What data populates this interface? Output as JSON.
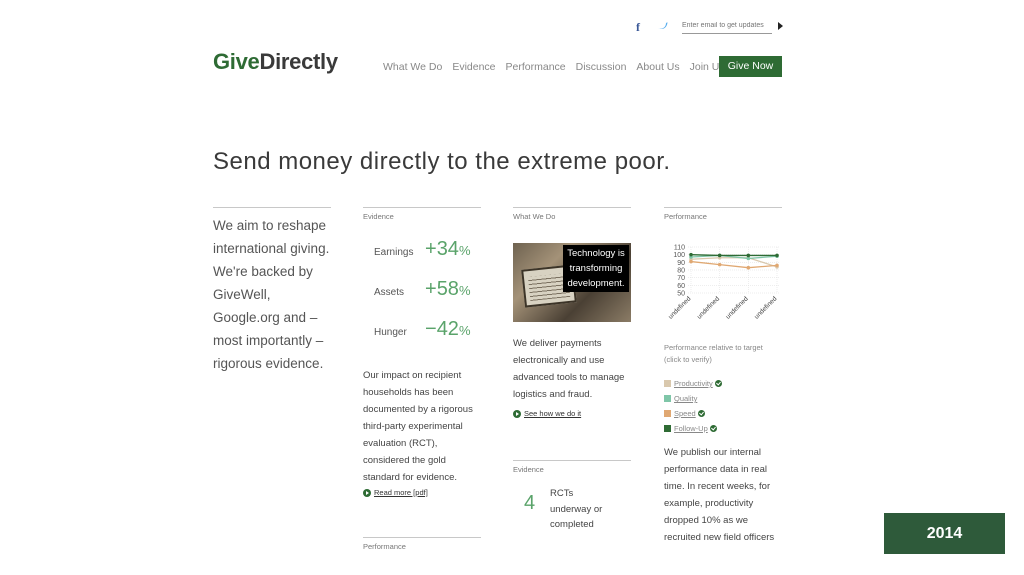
{
  "header": {
    "social": {
      "facebook_icon": "facebook-icon",
      "twitter_icon": "twitter-icon"
    },
    "email_placeholder": "Enter email to get updates",
    "logo_part1": "Give",
    "logo_part2": "Directly",
    "nav": [
      "What We Do",
      "Evidence",
      "Performance",
      "Discussion",
      "About Us",
      "Join Us"
    ],
    "cta": "Give Now",
    "brand_color": "#2e6b34"
  },
  "headline": "Send money directly to the extreme poor.",
  "intro": "We aim to reshape international giving. We're backed by GiveWell, Google.org and – most importantly – rigorous evidence.",
  "evidence": {
    "label": "Evidence",
    "stats": [
      {
        "name": "Earnings",
        "sign": "+",
        "value": "34",
        "unit": "%"
      },
      {
        "name": "Assets",
        "sign": "+",
        "value": "58",
        "unit": "%"
      },
      {
        "name": "Hunger",
        "sign": "−",
        "value": "42",
        "unit": "%"
      }
    ],
    "text": "Our impact on recipient households has been documented by a rigorous third-party experimental evaluation (RCT), considered the gold standard for evidence.",
    "link": "Read more [pdf]"
  },
  "what_we_do": {
    "label": "What We Do",
    "overlay": "Technology is transforming development.",
    "text": "We deliver payments electronically and use advanced tools to manage logistics and fraud.",
    "link": "See how we do it"
  },
  "evidence2": {
    "label": "Evidence",
    "number": "4",
    "text": "RCTs underway or completed"
  },
  "performance2": {
    "label": "Performance"
  },
  "performance": {
    "label": "Performance",
    "caption": "Performance relative to target",
    "caption2": "(click to verify)",
    "legend": [
      {
        "label": "Productivity",
        "color": "#d9c8ad"
      },
      {
        "label": "Quality",
        "color": "#7fc6a8"
      },
      {
        "label": "Speed",
        "color": "#e0a872"
      },
      {
        "label": "Follow-Up",
        "color": "#2e6b34"
      }
    ],
    "text": "We publish our internal performance data in real time. In recent weeks, for example, productivity dropped 10% as we recruited new field officers"
  },
  "chart_data": {
    "type": "line",
    "categories": [
      "undefined",
      "undefined",
      "undefined",
      "undefined"
    ],
    "y_ticks": [
      "110",
      "100",
      "90",
      "80",
      "70",
      "60",
      "50"
    ],
    "ylim": [
      50,
      110
    ],
    "grid": true,
    "series": [
      {
        "name": "Productivity",
        "color": "#d9c8ad",
        "values": [
          94,
          96,
          96,
          84
        ]
      },
      {
        "name": "Quality",
        "color": "#7fc6a8",
        "values": [
          97,
          99,
          95,
          98
        ]
      },
      {
        "name": "Speed",
        "color": "#e0a872",
        "values": [
          91,
          87,
          83,
          86
        ]
      },
      {
        "name": "Follow-Up",
        "color": "#2e6b34",
        "values": [
          100,
          99,
          99,
          99
        ]
      }
    ]
  },
  "year_badge": "2014"
}
